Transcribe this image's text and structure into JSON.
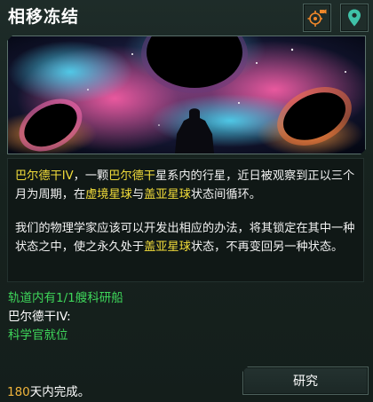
{
  "window": {
    "title": "相移冻结"
  },
  "toolbar": {
    "camera_icon": "target-camera-icon",
    "location_icon": "map-pin-icon"
  },
  "description": {
    "p1": [
      {
        "text": "巴尔德干IV",
        "hl": true
      },
      {
        "text": "，一颗",
        "hl": false
      },
      {
        "text": "巴尔德干",
        "hl": true
      },
      {
        "text": "星系内的行星，近日被观察到正以三个月为周期，在",
        "hl": false
      },
      {
        "text": "虚境星球",
        "hl": true
      },
      {
        "text": "与",
        "hl": false
      },
      {
        "text": "盖亚星球",
        "hl": true
      },
      {
        "text": "状态间循环。",
        "hl": false
      }
    ],
    "p2": [
      {
        "text": "我们的物理学家应该可以开发出相应的办法，将其锁定在其中一种状态之中，使之永久处于",
        "hl": false
      },
      {
        "text": "盖亚星球",
        "hl": true
      },
      {
        "text": "状态，不再变回另一种状态。",
        "hl": false
      }
    ]
  },
  "status": {
    "orbit": "轨道内有1/1艘科研船",
    "planet": "巴尔德干IV:",
    "scientist": "科学官就位"
  },
  "completion": {
    "days": "180",
    "suffix": "天内完成。"
  },
  "actions": {
    "research_label": "研究"
  },
  "colors": {
    "highlight": "#f2dd3a",
    "status_green": "#3ed55a",
    "days_orange": "#f0b43c"
  }
}
